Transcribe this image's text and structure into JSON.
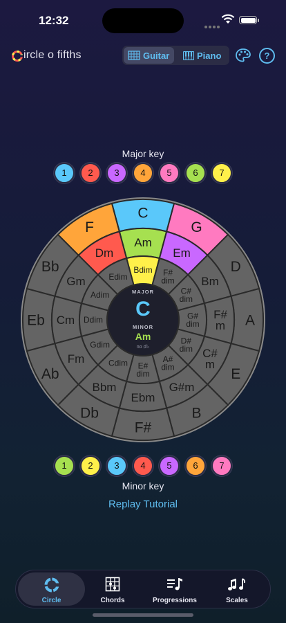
{
  "status_bar": {
    "time": "12:32"
  },
  "header": {
    "app_title": "ircle o fifths",
    "mode_toggle": {
      "guitar": "Guitar",
      "piano": "Piano",
      "selected": "Guitar"
    }
  },
  "major_key": {
    "label": "Major key",
    "degrees": [
      {
        "num": "1",
        "color": "#5ac8fa"
      },
      {
        "num": "2",
        "color": "#ff5a4e"
      },
      {
        "num": "3",
        "color": "#c968ff"
      },
      {
        "num": "4",
        "color": "#ffa53a"
      },
      {
        "num": "5",
        "color": "#ff7ac0"
      },
      {
        "num": "6",
        "color": "#a6e050"
      },
      {
        "num": "7",
        "color": "#fff04a"
      }
    ]
  },
  "circle": {
    "major_ring": [
      "C",
      "G",
      "D",
      "A",
      "E",
      "B",
      "F#",
      "Db",
      "Ab",
      "Eb",
      "Bb",
      "F"
    ],
    "minor_ring": [
      "Am",
      "Em",
      "Bm",
      "F#\nm",
      "C#\nm",
      "G#m",
      "Ebm",
      "Bbm",
      "Fm",
      "Cm",
      "Gm",
      "Dm"
    ],
    "dim_ring": [
      "Bdim",
      "F#\ndim",
      "C#\ndim",
      "G#\ndim",
      "D#\ndim",
      "A#\ndim",
      "E#\ndim",
      "Cdim",
      "Gdim",
      "Ddim",
      "Adim",
      "Edim"
    ],
    "center": {
      "major_label": "MAJOR",
      "major_key": "C",
      "minor_label": "MINOR",
      "minor_key": "Am",
      "accidentals": "no ♯/♭"
    }
  },
  "minor_key": {
    "label": "Minor key",
    "degrees": [
      {
        "num": "1",
        "color": "#a6e050"
      },
      {
        "num": "2",
        "color": "#fff04a"
      },
      {
        "num": "3",
        "color": "#5ac8fa"
      },
      {
        "num": "4",
        "color": "#ff5a4e"
      },
      {
        "num": "5",
        "color": "#c968ff"
      },
      {
        "num": "6",
        "color": "#ffa53a"
      },
      {
        "num": "7",
        "color": "#ff7ac0"
      }
    ]
  },
  "tutorial_link": "Replay Tutorial",
  "tab_bar": {
    "tabs": [
      {
        "label": "Circle",
        "icon": "circle-icon"
      },
      {
        "label": "Chords",
        "icon": "chord-grid-icon"
      },
      {
        "label": "Progressions",
        "icon": "music-list-icon"
      },
      {
        "label": "Scales",
        "icon": "music-notes-icon"
      }
    ],
    "selected": "Circle"
  },
  "colors": {
    "accent": "#5fbdf0",
    "wheel_gray": "#646464",
    "segment_line": "#2a2a2a",
    "tonic": "#5ac8fa",
    "supertonic": "#ff5a4e",
    "mediant": "#c968ff",
    "subdominant": "#ffa53a",
    "dominant": "#ff7ac0",
    "submediant": "#a6e050",
    "leading": "#fff04a"
  }
}
